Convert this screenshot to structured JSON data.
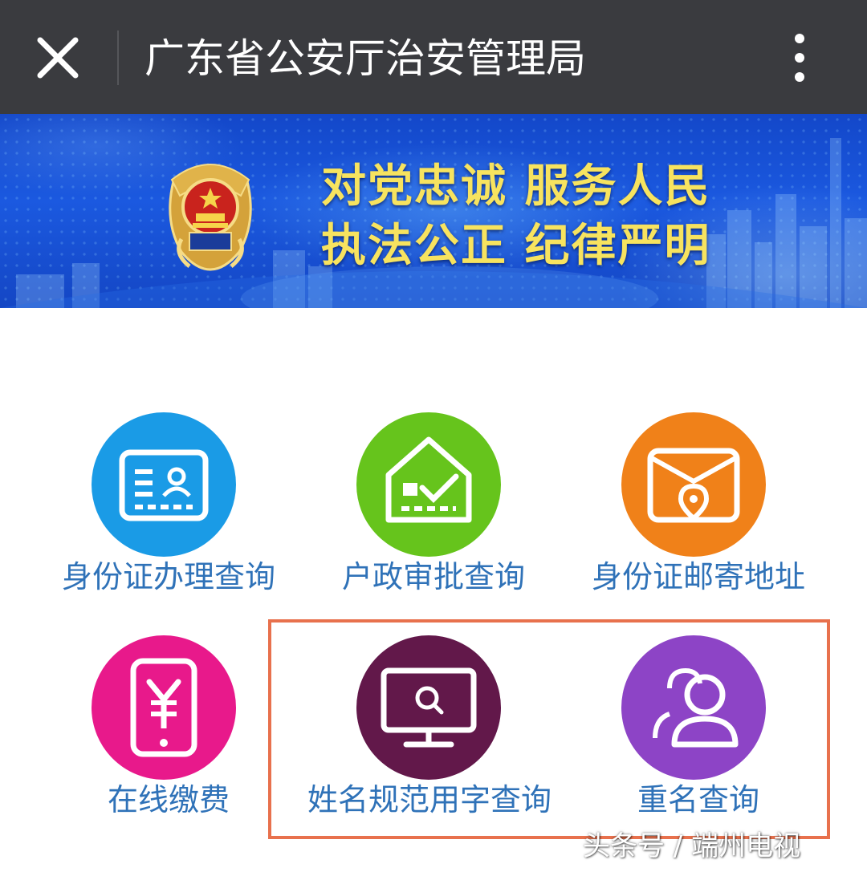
{
  "header": {
    "title": "广东省公安厅治安管理局",
    "close_icon": "close-icon",
    "more_icon": "more-vertical-icon"
  },
  "banner": {
    "emblem": "police-emblem",
    "slogan_line1": "对党忠诚 服务人民",
    "slogan_line2": "执法公正 纪律严明"
  },
  "services": [
    {
      "label": "身份证办理查询",
      "icon": "id-card-icon",
      "color": "#1a9be6"
    },
    {
      "label": "户政审批查询",
      "icon": "house-check-icon",
      "color": "#66c41c"
    },
    {
      "label": "身份证邮寄地址",
      "icon": "mail-location-icon",
      "color": "#f08119"
    },
    {
      "label": "在线缴费",
      "icon": "phone-yuan-icon",
      "color": "#e8198b"
    },
    {
      "label": "姓名规范用字查询",
      "icon": "monitor-search-icon",
      "color": "#62184a"
    },
    {
      "label": "重名查询",
      "icon": "users-icon",
      "color": "#8d44c6"
    }
  ],
  "watermark": "头条号 / 端州电视"
}
